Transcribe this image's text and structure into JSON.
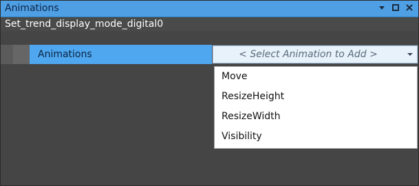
{
  "window": {
    "title": "Animations",
    "object_name": "Set_trend_display_mode_digital0"
  },
  "controls": {
    "pin_icon": "pin-icon",
    "maximize_icon": "maximize-icon",
    "close_icon": "close-icon"
  },
  "property_row": {
    "label": "Animations",
    "dropdown_value": "< Select Animation to Add >",
    "dropdown_icon": "chevron-down-icon"
  },
  "menu": {
    "items": [
      "Move",
      "ResizeHeight",
      "ResizeWidth",
      "Visibility"
    ]
  },
  "colors": {
    "titlebar": "#4f9fe4",
    "selected_label": "#4ea7ef",
    "panel_bg": "#454545"
  }
}
